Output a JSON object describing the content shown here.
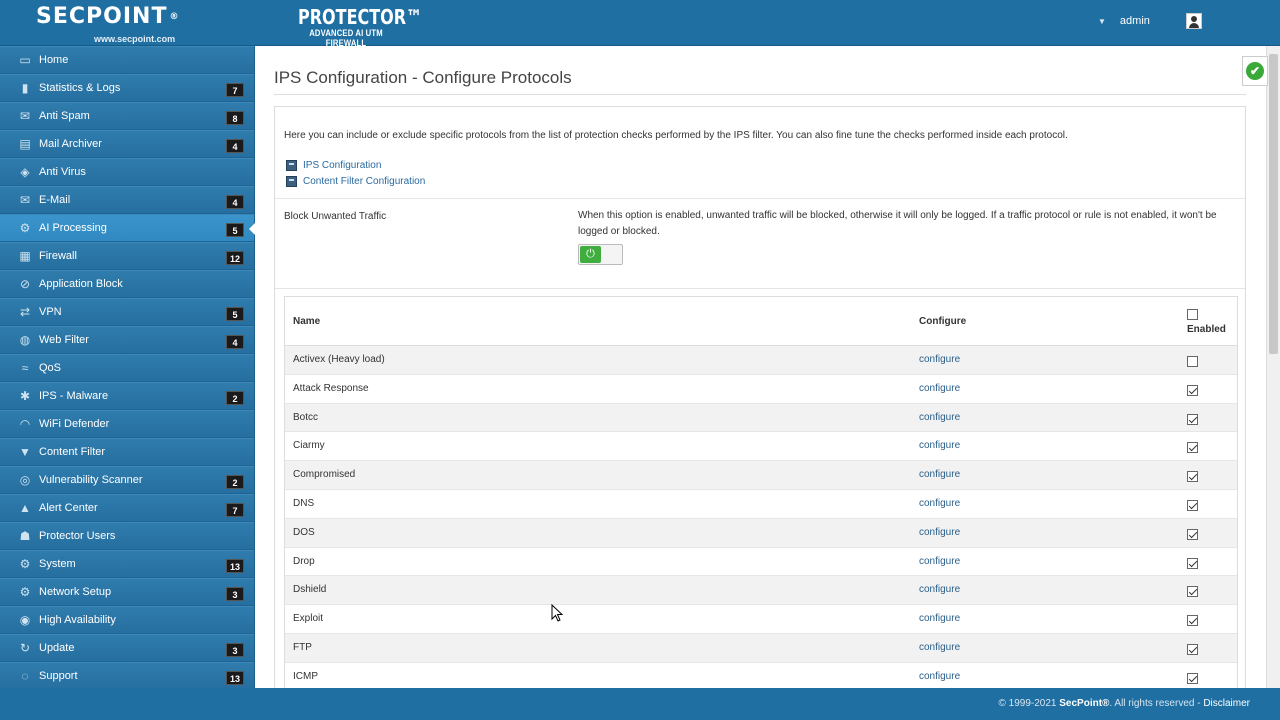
{
  "header": {
    "logo_text": "SECPOINT",
    "logo_reg": "®",
    "logo_url": "www.secpoint.com",
    "product_name": "PROTECTOR™",
    "product_sub": "ADVANCED AI UTM FIREWALL",
    "user_caret": "▼",
    "user_name": "admin"
  },
  "sidebar": {
    "items": [
      {
        "label": "Home",
        "icon": "monitor-icon",
        "glyph": "▭",
        "badge": ""
      },
      {
        "label": "Statistics & Logs",
        "icon": "bar-chart-icon",
        "glyph": "▮",
        "badge": "7"
      },
      {
        "label": "Anti Spam",
        "icon": "mail-filter-icon",
        "glyph": "✉",
        "badge": "8"
      },
      {
        "label": "Mail Archiver",
        "icon": "archive-icon",
        "glyph": "▤",
        "badge": "4"
      },
      {
        "label": "Anti Virus",
        "icon": "shield-icon",
        "glyph": "◈",
        "badge": ""
      },
      {
        "label": "E-Mail",
        "icon": "email-icon",
        "glyph": "✉",
        "badge": "4"
      },
      {
        "label": "AI Processing",
        "icon": "gear-icon",
        "glyph": "⚙",
        "badge": "5"
      },
      {
        "label": "Firewall",
        "icon": "firewall-icon",
        "glyph": "▦",
        "badge": "12"
      },
      {
        "label": "Application Block",
        "icon": "app-block-icon",
        "glyph": "⊘",
        "badge": ""
      },
      {
        "label": "VPN",
        "icon": "vpn-icon",
        "glyph": "⇄",
        "badge": "5"
      },
      {
        "label": "Web Filter",
        "icon": "globe-icon",
        "glyph": "◍",
        "badge": "4"
      },
      {
        "label": "QoS",
        "icon": "qos-icon",
        "glyph": "≈",
        "badge": ""
      },
      {
        "label": "IPS - Malware",
        "icon": "bug-icon",
        "glyph": "✱",
        "badge": "2"
      },
      {
        "label": "WiFi Defender",
        "icon": "wifi-icon",
        "glyph": "◠",
        "badge": ""
      },
      {
        "label": "Content Filter",
        "icon": "filter-icon",
        "glyph": "▼",
        "badge": ""
      },
      {
        "label": "Vulnerability Scanner",
        "icon": "scanner-icon",
        "glyph": "◎",
        "badge": "2"
      },
      {
        "label": "Alert Center",
        "icon": "warning-icon",
        "glyph": "▲",
        "badge": "7"
      },
      {
        "label": "Protector Users",
        "icon": "users-icon",
        "glyph": "☗",
        "badge": ""
      },
      {
        "label": "System",
        "icon": "system-gear-icon",
        "glyph": "⚙",
        "badge": "13"
      },
      {
        "label": "Network Setup",
        "icon": "network-icon",
        "glyph": "⚙",
        "badge": "3"
      },
      {
        "label": "High Availability",
        "icon": "availability-icon",
        "glyph": "◉",
        "badge": ""
      },
      {
        "label": "Update",
        "icon": "refresh-icon",
        "glyph": "↻",
        "badge": "3"
      },
      {
        "label": "Support",
        "icon": "support-icon",
        "glyph": "◌",
        "badge": "13"
      }
    ],
    "active_index": 6
  },
  "main": {
    "title": "IPS Configuration - Configure Protocols",
    "intro": "Here you can include or exclude specific protocols from the list of protection checks performed by the IPS filter. You can also fine tune the checks performed inside each protocol.",
    "links": [
      "IPS Configuration",
      "Content Filter Configuration"
    ],
    "block_label": "Block Unwanted Traffic",
    "block_desc": "When this option is enabled, unwanted traffic will be blocked, otherwise it will only be logged. If a traffic protocol or rule is not enabled, it won't be logged or blocked.",
    "toggle_on": true,
    "toggle_glyph": "⏻"
  },
  "table": {
    "col_name": "Name",
    "col_configure": "Configure",
    "col_enabled": "Enabled",
    "header_checked": false,
    "rows": [
      {
        "name": "Activex (Heavy load)",
        "action": "configure",
        "enabled": false
      },
      {
        "name": "Attack Response",
        "action": "configure",
        "enabled": true
      },
      {
        "name": "Botcc",
        "action": "configure",
        "enabled": true
      },
      {
        "name": "Ciarmy",
        "action": "configure",
        "enabled": true
      },
      {
        "name": "Compromised",
        "action": "configure",
        "enabled": true
      },
      {
        "name": "DNS",
        "action": "configure",
        "enabled": true
      },
      {
        "name": "DOS",
        "action": "configure",
        "enabled": true
      },
      {
        "name": "Drop",
        "action": "configure",
        "enabled": true
      },
      {
        "name": "Dshield",
        "action": "configure",
        "enabled": true
      },
      {
        "name": "Exploit",
        "action": "configure",
        "enabled": true
      },
      {
        "name": "FTP",
        "action": "configure",
        "enabled": true
      },
      {
        "name": "ICMP",
        "action": "configure",
        "enabled": true
      }
    ]
  },
  "status": {
    "check_glyph": "✔"
  },
  "footer": {
    "copyright": "© 1999-2021 ",
    "brand": "SecPoint®",
    "rights": ". All rights reserved - ",
    "disclaimer": "Disclaimer"
  },
  "colors": {
    "brand_blue": "#1f6fa3",
    "active_blue": "#3089c0",
    "success_green": "#3fae3f"
  }
}
